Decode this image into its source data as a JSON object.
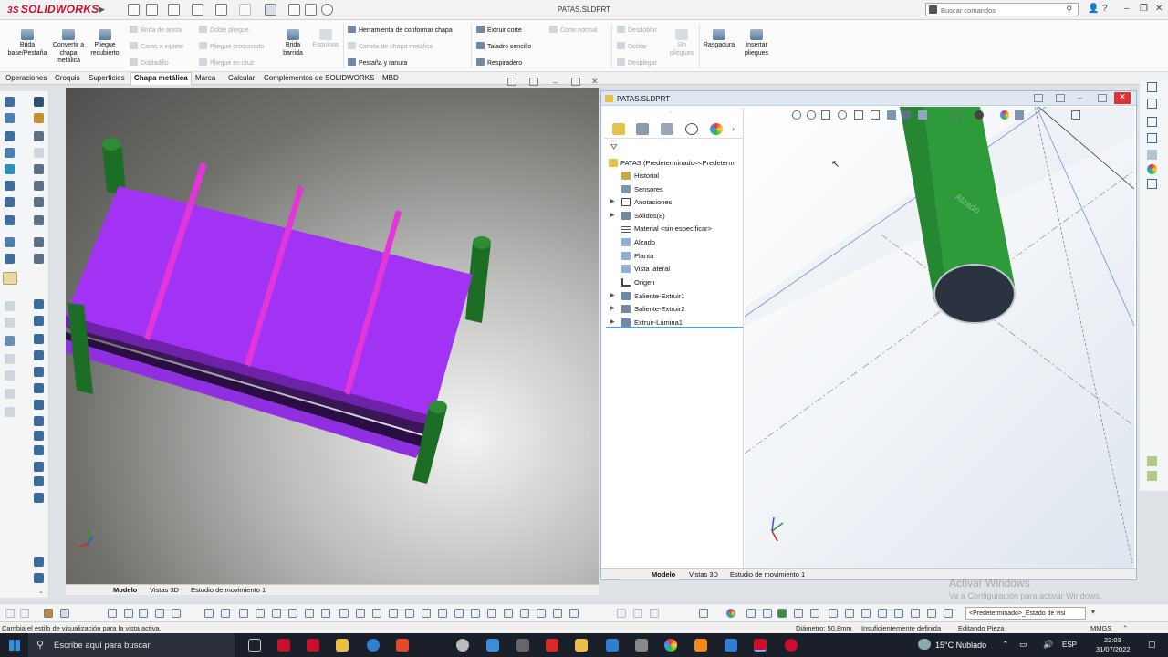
{
  "app": {
    "logo": "SOLIDWORKS",
    "document_title": "PATAS.SLDPRT",
    "search_placeholder": "Buscar comandos"
  },
  "ribbon": {
    "big_buttons": [
      {
        "label": "Brida base/Pestaña",
        "icon": "base-flange-icon"
      },
      {
        "label": "Convertir a chapa metálica",
        "icon": "convert-sheet-metal-icon"
      },
      {
        "label": "Pliegue recubierto",
        "icon": "lofted-bend-icon"
      },
      {
        "label": "Brida barrida",
        "icon": "swept-flange-icon"
      },
      {
        "label": "Esquinas",
        "icon": "corners-icon"
      },
      {
        "label": "Sin pliegues",
        "icon": "no-bends-icon"
      },
      {
        "label": "Rasgadura",
        "icon": "rip-icon"
      },
      {
        "label": "Insertar pliegues",
        "icon": "insert-bends-icon"
      }
    ],
    "col1": [
      "Brida de arista",
      "Caras a inglete",
      "Dobladillo"
    ],
    "col2": [
      "Doble pliegue",
      "Cartela de chapa metálica",
      "Pliegue en cruz"
    ],
    "col2_disabled_first": "Pliegue croquizado",
    "col3": [
      "Herramienta de conformar chapa",
      "Cartela de chapa metálica",
      "Pestaña y ranura"
    ],
    "col4": [
      "Extruir corte",
      "Taladro sencillo",
      "Respiradero"
    ],
    "col5": [
      "Corte normal"
    ],
    "col6": [
      "Desdoblar",
      "Doblar",
      "Desplegar"
    ]
  },
  "command_tabs": [
    "Operaciones",
    "Croquis",
    "Superficies",
    "Chapa metálica",
    "Marca",
    "Calcular",
    "Complementos de SOLIDWORKS",
    "MBD"
  ],
  "active_command_tab": "Chapa metálica",
  "viewport_tabs": [
    "Modelo",
    "Vistas 3D",
    "Estudio de movimiento 1"
  ],
  "window2": {
    "title": "PATAS.SLDPRT",
    "tree_root": "PATAS  (Predeterminado<<Predeterm",
    "tree_items": [
      {
        "label": "Historial",
        "arrow": false,
        "icon": "history-icon"
      },
      {
        "label": "Sensores",
        "arrow": false,
        "icon": "sensor-icon"
      },
      {
        "label": "Anotaciones",
        "arrow": true,
        "icon": "annotations-icon"
      },
      {
        "label": "Sólidos(8)",
        "arrow": true,
        "icon": "solid-bodies-icon"
      },
      {
        "label": "Material <sin especificar>",
        "arrow": false,
        "icon": "material-icon"
      },
      {
        "label": "Alzado",
        "arrow": false,
        "icon": "plane-icon"
      },
      {
        "label": "Planta",
        "arrow": false,
        "icon": "plane-icon"
      },
      {
        "label": "Vista lateral",
        "arrow": false,
        "icon": "plane-icon"
      },
      {
        "label": "Origen",
        "arrow": false,
        "icon": "origin-icon"
      },
      {
        "label": "Saliente-Extruir1",
        "arrow": true,
        "icon": "extrude-icon"
      },
      {
        "label": "Saliente-Extruir2",
        "arrow": true,
        "icon": "extrude-icon"
      },
      {
        "label": "Extruir-Lámina1",
        "arrow": true,
        "icon": "thin-extrude-icon"
      }
    ],
    "plane_label": "Alzado"
  },
  "bottom_toolbar": {
    "config": "<Predeterminado>_Estado de visi"
  },
  "statusbar": {
    "hint": "Cambia el estilo de visualización para la vista activa.",
    "diameter": "Diámetro: 50.8mm",
    "definition": "Insuficientemente definida",
    "mode": "Editando Pieza",
    "units": "MMGS"
  },
  "watermark": {
    "line1": "Activar Windows",
    "line2": "Ve a Configuración para activar Windows."
  },
  "taskbar": {
    "search": "Escribe aquí para buscar",
    "weather": "15°C  Nublado",
    "lang": "ESP",
    "time": "22:03",
    "date": "31/07/2022"
  },
  "colors": {
    "plate": "#a233f5",
    "slat": "#e436d8",
    "leg": "#1d6e25",
    "leg_right": "#2e9b3a",
    "brand": "#c8102e"
  }
}
